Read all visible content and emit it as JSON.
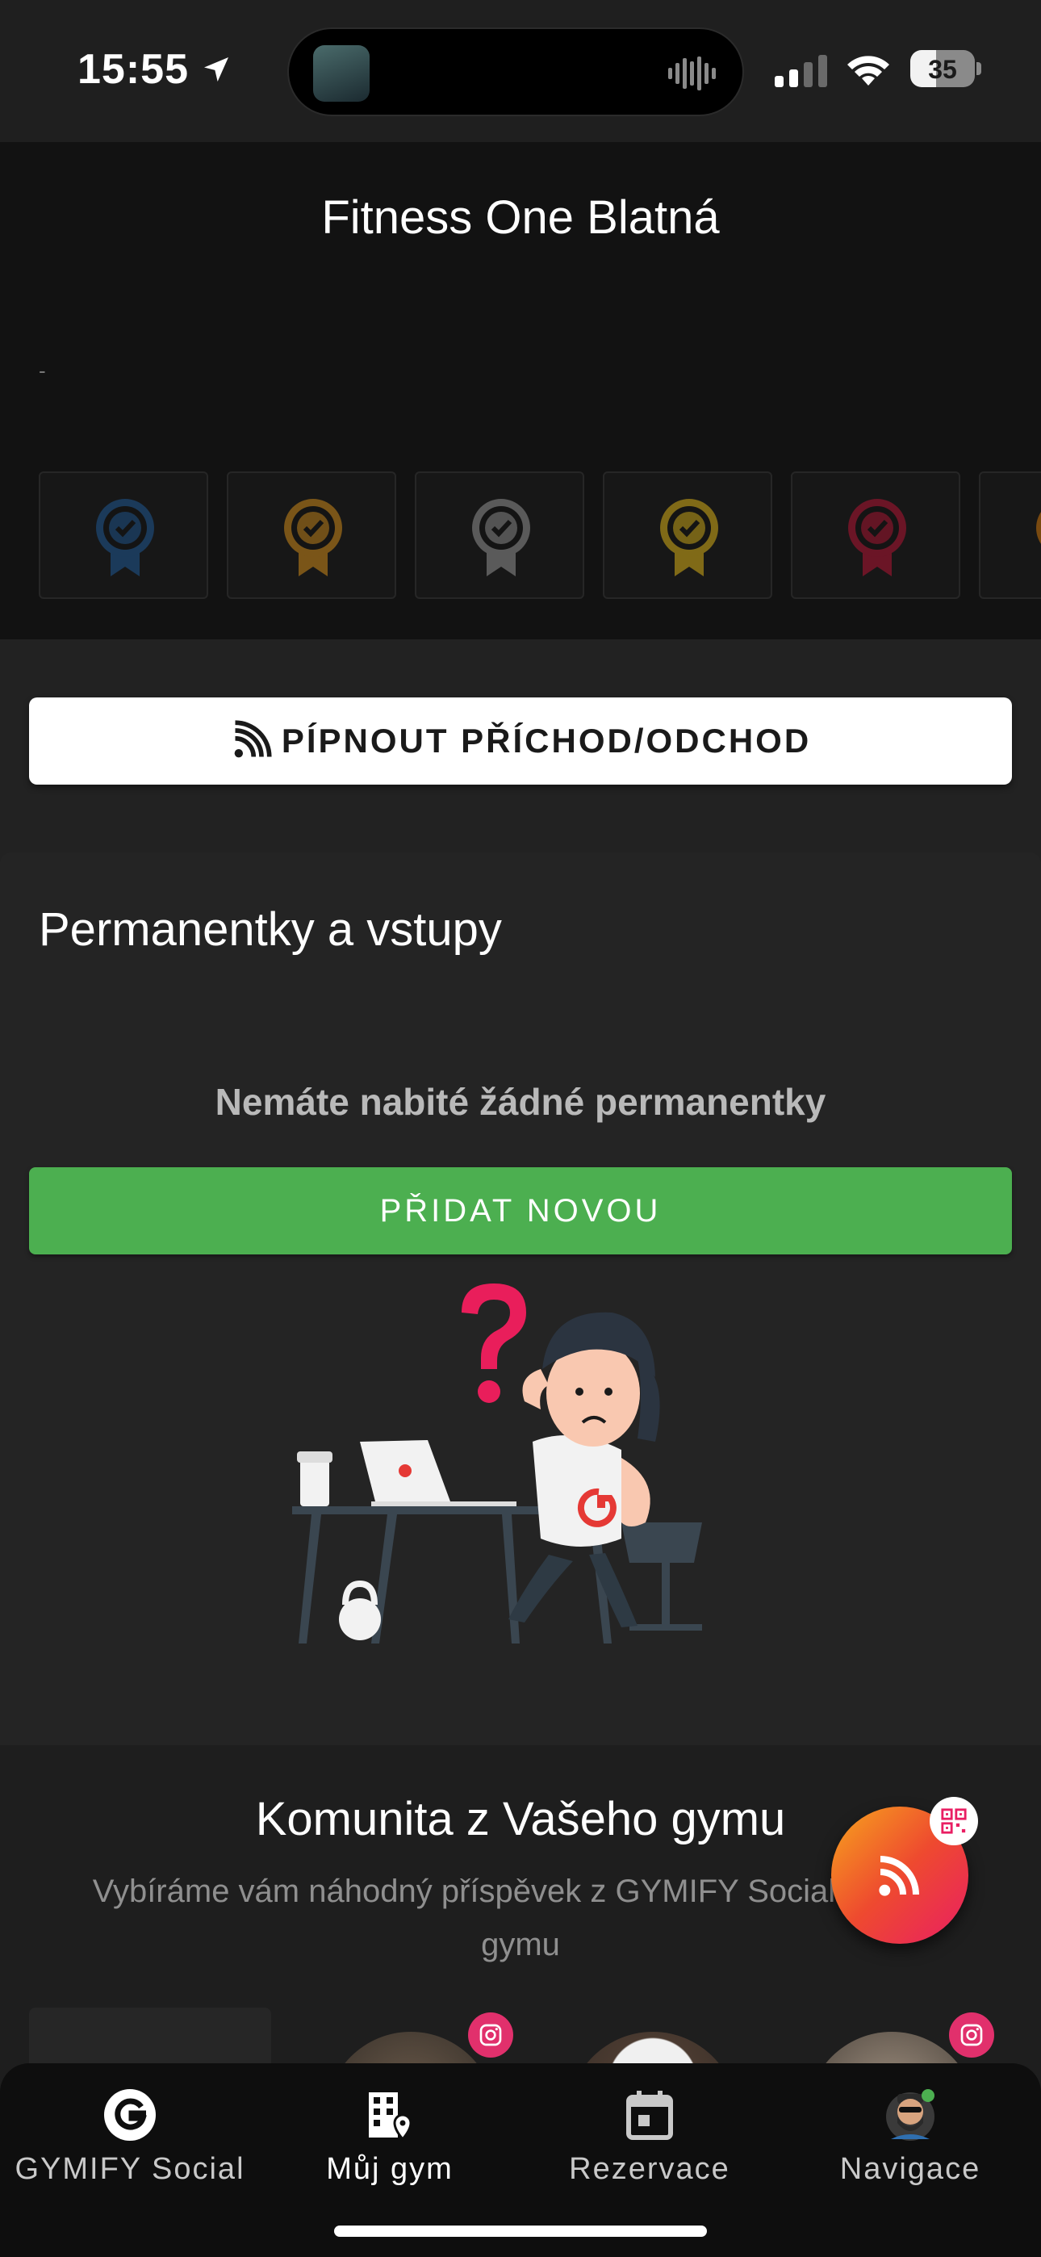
{
  "status_bar": {
    "time": "15:55",
    "battery": "35",
    "icons": [
      "location-arrow-icon",
      "signal-icon",
      "wifi-icon",
      "battery-icon",
      "audio-wave-icon"
    ]
  },
  "header": {
    "gym_name": "Fitness One Blatná",
    "subtitle": "-",
    "badges": [
      {
        "name": "badge-blue",
        "color": "#1b3a5a"
      },
      {
        "name": "badge-bronze",
        "color": "#7a5518"
      },
      {
        "name": "badge-silver",
        "color": "#5a5a5a"
      },
      {
        "name": "badge-gold",
        "color": "#806a17"
      },
      {
        "name": "badge-red",
        "color": "#6b1526"
      },
      {
        "name": "badge-orange",
        "color": "#7a4a10"
      }
    ]
  },
  "checkin": {
    "label": "PÍPNOUT PŘÍCHOD/ODCHOD",
    "icon": "rss-icon"
  },
  "permanentky": {
    "title": "Permanentky a vstupy",
    "empty_text": "Nemáte nabité žádné permanentky",
    "add_label": "PŘIDAT NOVOU",
    "colors": {
      "add_button": "#4caf50"
    }
  },
  "community": {
    "title": "Komunita z Vašeho gymu",
    "subtitle": "Vybíráme vám náhodný příspěvek z GYMIFY Social vašeho gymu"
  },
  "fab": {
    "icon": "rss-icon",
    "badge_icon": "qr-code-icon"
  },
  "bottom_nav": {
    "items": [
      {
        "label": "GYMIFY Social",
        "icon": "gymify-logo-icon",
        "active": false
      },
      {
        "label": "Můj gym",
        "icon": "building-location-icon",
        "active": true
      },
      {
        "label": "Rezervace",
        "icon": "calendar-icon",
        "active": false
      },
      {
        "label": "Navigace",
        "icon": "profile-avatar-icon",
        "active": false
      }
    ]
  }
}
